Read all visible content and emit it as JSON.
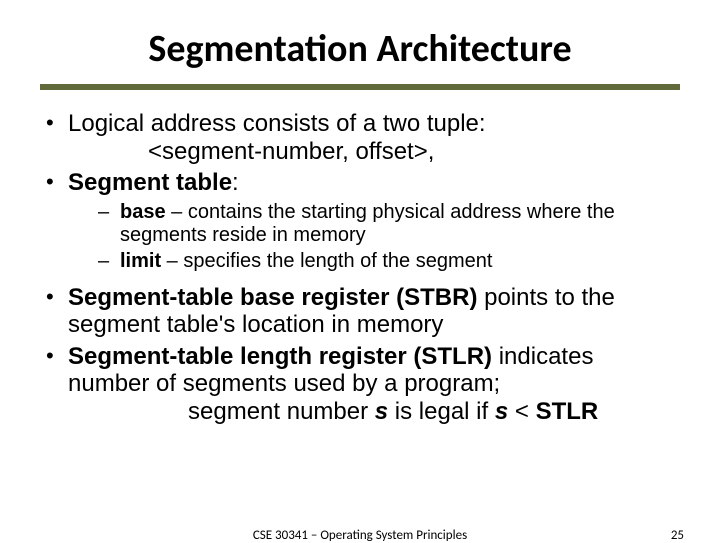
{
  "title": "Segmentation Architecture",
  "b1": {
    "line1": "Logical address consists of a two tuple:",
    "line2": "<segment-number, offset>,"
  },
  "b2": {
    "label1": "Segment table",
    "colon": ":",
    "sub1": {
      "kw": "base",
      "rest": " – contains the starting physical address where the segments reside in memory"
    },
    "sub2": {
      "kw": "limit",
      "rest": " – specifies the length of the segment"
    }
  },
  "b3": {
    "bold": "Segment-table base register (STBR)",
    "rest": " points to the segment table's location in memory"
  },
  "b4": {
    "bold": "Segment-table length register (STLR)",
    "rest1": " indicates number of segments used by a program;",
    "cond_a": "segment number ",
    "s1": "s",
    "mid": " is legal if ",
    "s2": "s",
    "lt": " < ",
    "stlr": "STLR"
  },
  "footer": {
    "center": "CSE 30341 – Operating System Principles",
    "page": "25"
  }
}
